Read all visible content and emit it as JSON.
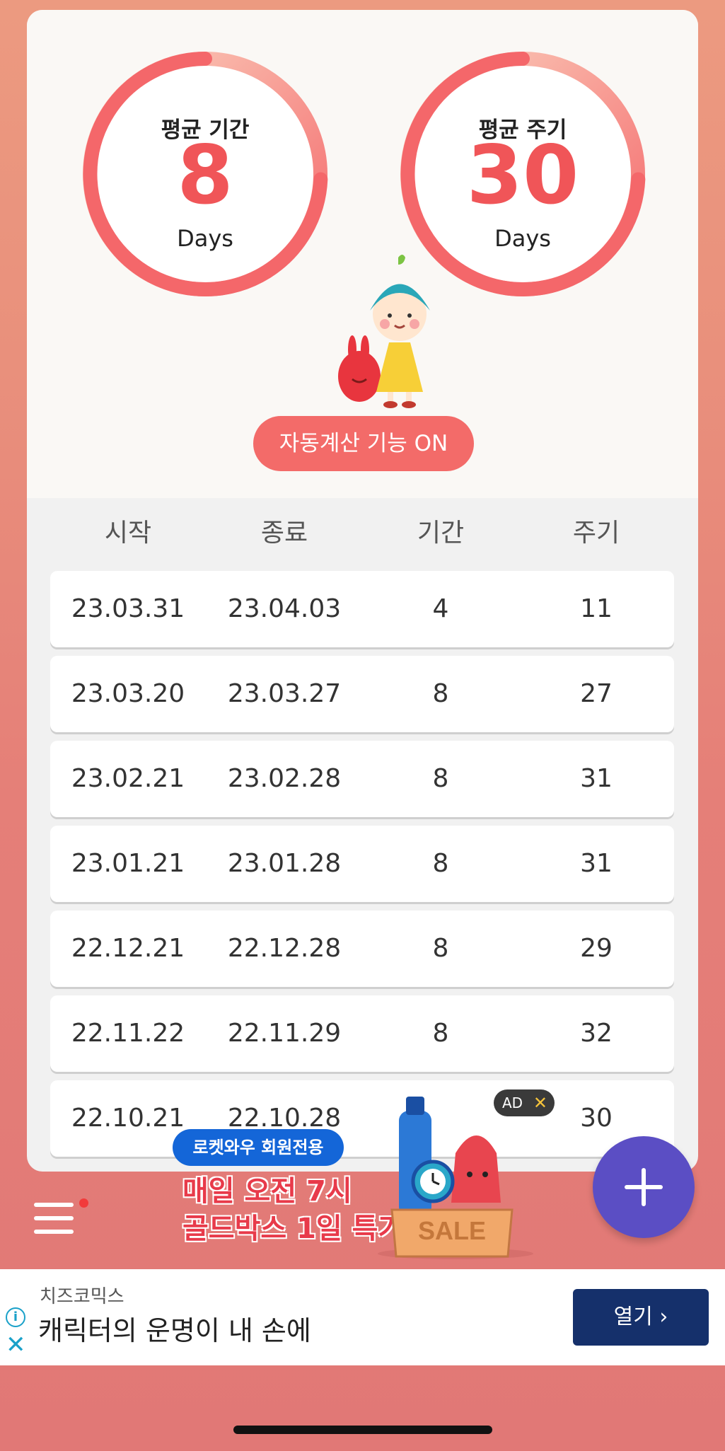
{
  "summary": {
    "avg_period": {
      "label": "평균 기간",
      "value": "8",
      "unit": "Days"
    },
    "avg_cycle": {
      "label": "평균 주기",
      "value": "30",
      "unit": "Days"
    },
    "auto_calc_button": "자동계산 기능 ON"
  },
  "table": {
    "headers": [
      "시작",
      "종료",
      "기간",
      "주기"
    ],
    "rows": [
      {
        "start": "23.03.31",
        "end": "23.04.03",
        "period": "4",
        "cycle": "11"
      },
      {
        "start": "23.03.20",
        "end": "23.03.27",
        "period": "8",
        "cycle": "27"
      },
      {
        "start": "23.02.21",
        "end": "23.02.28",
        "period": "8",
        "cycle": "31"
      },
      {
        "start": "23.01.21",
        "end": "23.01.28",
        "period": "8",
        "cycle": "31"
      },
      {
        "start": "22.12.21",
        "end": "22.12.28",
        "period": "8",
        "cycle": "29"
      },
      {
        "start": "22.11.22",
        "end": "22.11.29",
        "period": "8",
        "cycle": "32"
      },
      {
        "start": "22.10.21",
        "end": "22.10.28",
        "period": "",
        "cycle": "30"
      }
    ]
  },
  "promo": {
    "pill": "로켓와우 회원전용",
    "line1": "매일 오전 7시",
    "line2": "골드박스 1일 특가",
    "box_label": "SALE",
    "ad_tag": "AD"
  },
  "ad_banner": {
    "source": "치즈코믹스",
    "text": "캐릭터의 운명이 내 손에",
    "open_button": "열기"
  },
  "icons": {
    "menu": "hamburger-menu-icon",
    "add": "plus-icon",
    "info": "info-icon",
    "close": "close-icon",
    "chevron": "chevron-right-icon"
  },
  "colors": {
    "accent": "#f05558",
    "ring_light": "#fbc9b3",
    "fab": "#5b4ec4",
    "ad_button": "#15306b"
  }
}
